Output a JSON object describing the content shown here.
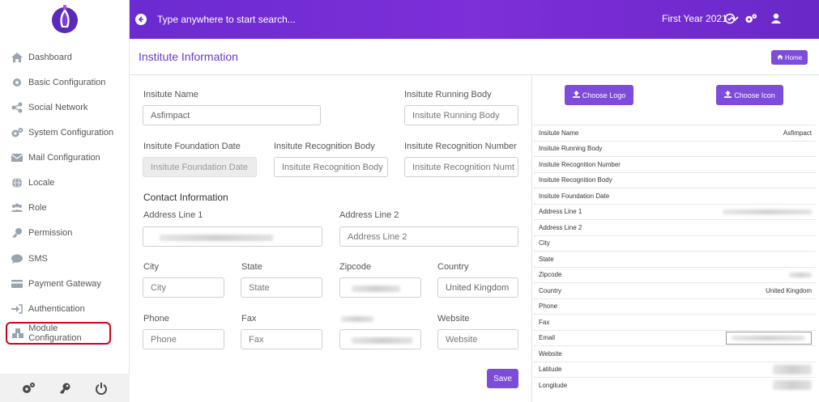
{
  "topbar": {
    "search_placeholder": "Type anywhere to start search...",
    "year_selector": "First Year 2021"
  },
  "sidebar": {
    "items": [
      {
        "label": "Dashboard",
        "icon": "home-icon"
      },
      {
        "label": "Basic Configuration",
        "icon": "gear-icon"
      },
      {
        "label": "Social Network",
        "icon": "share-icon"
      },
      {
        "label": "System Configuration",
        "icon": "gears-icon"
      },
      {
        "label": "Mail Configuration",
        "icon": "envelope-icon"
      },
      {
        "label": "Locale",
        "icon": "globe-icon"
      },
      {
        "label": "Role",
        "icon": "users-icon"
      },
      {
        "label": "Permission",
        "icon": "key-icon"
      },
      {
        "label": "SMS",
        "icon": "chat-bubble-icon"
      },
      {
        "label": "Payment Gateway",
        "icon": "credit-card-icon"
      },
      {
        "label": "Authentication",
        "icon": "sign-in-icon"
      },
      {
        "label": "Module Configuration",
        "icon": "cubes-icon"
      }
    ]
  },
  "page": {
    "title": "Institute Information",
    "home_label": "Home"
  },
  "form": {
    "name_label": "Insitute Name",
    "name_value": "Asfimpact",
    "running_body_label": "Insitute Running Body",
    "running_body_placeholder": "Insitute Running Body",
    "foundation_label": "Insitute Foundation Date",
    "foundation_placeholder": "Insitute Foundation Date",
    "recognition_body_label": "Insitute Recognition Body",
    "recognition_body_placeholder": "Insitute Recognition Body",
    "recognition_number_label": "Insitute Recognition Number",
    "recognition_number_placeholder": "Insitute Recognition Numt",
    "contact_title": "Contact Information",
    "address1_label": "Address Line 1",
    "address2_label": "Address Line 2",
    "address2_placeholder": "Address Line 2",
    "city_label": "City",
    "city_placeholder": "City",
    "state_label": "State",
    "state_placeholder": "State",
    "zipcode_label": "Zipcode",
    "country_label": "Country",
    "country_value": "United Kingdom",
    "phone_label": "Phone",
    "phone_placeholder": "Phone",
    "fax_label": "Fax",
    "fax_placeholder": "Fax",
    "website_label": "Website",
    "website_placeholder": "Website",
    "save_label": "Save"
  },
  "panel": {
    "choose_logo": "Choose Logo",
    "choose_icon": "Choose Icon",
    "rows": [
      {
        "label": "Insitute Name",
        "value": "Asfimpact"
      },
      {
        "label": "Insitute Running Body",
        "value": ""
      },
      {
        "label": "Insitute Recognition Number",
        "value": ""
      },
      {
        "label": "Insitute Recognition Body",
        "value": ""
      },
      {
        "label": "Insitute Foundation Date",
        "value": ""
      },
      {
        "label": "Address Line 1",
        "value": ""
      },
      {
        "label": "Address Line 2",
        "value": ""
      },
      {
        "label": "City",
        "value": ""
      },
      {
        "label": "State",
        "value": ""
      },
      {
        "label": "Zipcode",
        "value": ""
      },
      {
        "label": "Country",
        "value": "United Kingdom"
      },
      {
        "label": "Phone",
        "value": ""
      },
      {
        "label": "Fax",
        "value": ""
      },
      {
        "label": "Email",
        "value": ""
      },
      {
        "label": "Website",
        "value": ""
      },
      {
        "label": "Latitude",
        "value": ""
      },
      {
        "label": "Longitude",
        "value": ""
      }
    ]
  },
  "colors": {
    "accent": "#7d4cdb",
    "topbar": "#6b2bd0",
    "highlight": "#d0021b"
  }
}
